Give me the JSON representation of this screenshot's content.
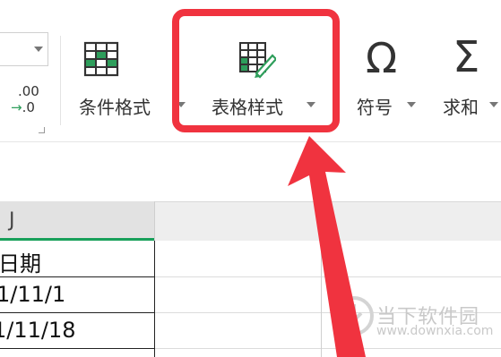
{
  "ribbon": {
    "number_format": {
      "decimal_top": ".00",
      "decimal_bottom_arrow": "→",
      "decimal_bottom": ".0"
    },
    "tools": [
      {
        "label": "条件格式",
        "icon": "conditional-format-icon"
      },
      {
        "label": "表格样式",
        "icon": "table-style-icon"
      },
      {
        "label": "符号",
        "icon": "omega-icon",
        "glyph": "Ω"
      },
      {
        "label": "求和",
        "icon": "sigma-icon",
        "glyph": "Σ"
      }
    ]
  },
  "sheet": {
    "columns": [
      {
        "name": "J"
      }
    ],
    "rows": [
      {
        "value": "日期"
      },
      {
        "value": "1/11/1"
      },
      {
        "value": "1/11/18"
      }
    ]
  },
  "watermark": {
    "text": "当下软件园",
    "url": "www.downxia.com"
  },
  "colors": {
    "highlight": "#f0333f",
    "selected_column": "#18a05a",
    "icon_green": "#2e9e5b"
  }
}
